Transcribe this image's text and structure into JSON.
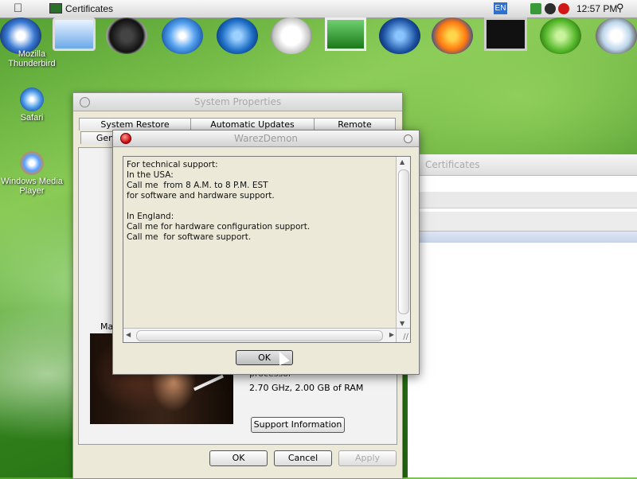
{
  "menubar": {
    "app_name": "Certificates",
    "language": "EN",
    "clock": "12:57 PM"
  },
  "desktop": {
    "icons": [
      {
        "label": "Mozilla\nThunderbird"
      },
      {
        "label": "Safari"
      },
      {
        "label": "Windows Media\nPlayer"
      }
    ]
  },
  "system_properties": {
    "title": "System Properties",
    "tabs_row1": [
      "System Restore",
      "Automatic Updates",
      "Remote"
    ],
    "tabs_row2": [
      "Gen"
    ],
    "ma_label": "Ma",
    "spec_processor": "processor",
    "spec_memory": "2.70 GHz, 2.00 GB of RAM",
    "support_button": "Support Information",
    "ok": "OK",
    "cancel": "Cancel",
    "apply": "Apply"
  },
  "certificates_window": {
    "title": "Certificates"
  },
  "dialog": {
    "title": "WarezDemon",
    "lines": [
      "For technical support:",
      "In the USA:",
      "Call me  from 8 A.M. to 8 P.M. EST",
      "for software and hardware support.",
      "",
      "In England:",
      "Call me for hardware configuration support.",
      "Call me  for software support."
    ],
    "ok_label": "OK"
  },
  "colors": {
    "close_red": "#c80000",
    "dialog_bg": "#ece9d8",
    "desktop_green": "#4f9d2e"
  }
}
